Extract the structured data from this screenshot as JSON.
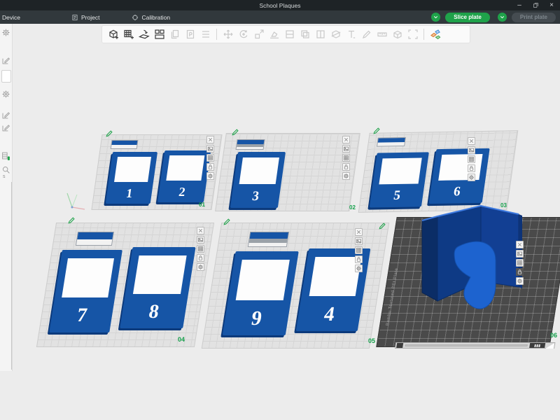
{
  "window": {
    "title": "School Plaques",
    "controls": [
      "minimize-icon",
      "restore-icon",
      "close-icon"
    ]
  },
  "menubar": {
    "tabs": [
      {
        "label": "Device"
      },
      {
        "label": "Project"
      },
      {
        "label": "Calibration"
      }
    ],
    "slice_label": "Slice plate",
    "print_label": "Print plate"
  },
  "toolbar": {
    "icons": [
      "add-model-icon",
      "add-plate-icon",
      "auto-orient-icon",
      "arrange-icon",
      "copy-icon",
      "paste-icon",
      "layers-icon",
      "move-icon",
      "rotate-icon",
      "scale-icon",
      "place-on-face-icon",
      "split-horizontal-icon",
      "clone-icon",
      "split-vertical-icon",
      "cut-icon",
      "text-icon",
      "seam-icon",
      "measure-icon",
      "assembly-icon",
      "scale-to-fit-icon",
      "split-to-parts-icon"
    ]
  },
  "sidebar": {
    "icons": [
      "gear-icon",
      "edit-preset-icon",
      "gear-icon",
      "edit-icon",
      "edit-icon",
      "filament-icon",
      "search-icon"
    ],
    "partial_text": "s"
  },
  "viewport": {
    "plates": [
      {
        "id": "01",
        "plaques": [
          "1",
          "2"
        ]
      },
      {
        "id": "02",
        "plaques": [
          "3"
        ]
      },
      {
        "id": "03",
        "plaques": [
          "5",
          "6"
        ]
      },
      {
        "id": "04",
        "plaques": [
          "7",
          "8"
        ]
      },
      {
        "id": "05",
        "plaques": [
          "9",
          "4"
        ]
      },
      {
        "id": "06",
        "plaques": [],
        "active": true,
        "brand_text": "Bambu Textured PEI Plate",
        "object": "blue-open-top-box"
      }
    ],
    "plate_corner_icons": [
      "delete-plate-icon",
      "plate-preview-icon",
      "arrange-plate-icon",
      "lock-plate-icon",
      "plate-settings-icon"
    ],
    "colors": {
      "accent_green": "#1fa24a",
      "plaque_blue": "#1655a6",
      "plate_label_green": "#13a04a",
      "active_plate_dark": "#4a4a4a",
      "object_blue_dark": "#0b2d66",
      "object_blue_mid": "#11459c",
      "object_blue_bright": "#1d63cf"
    }
  }
}
